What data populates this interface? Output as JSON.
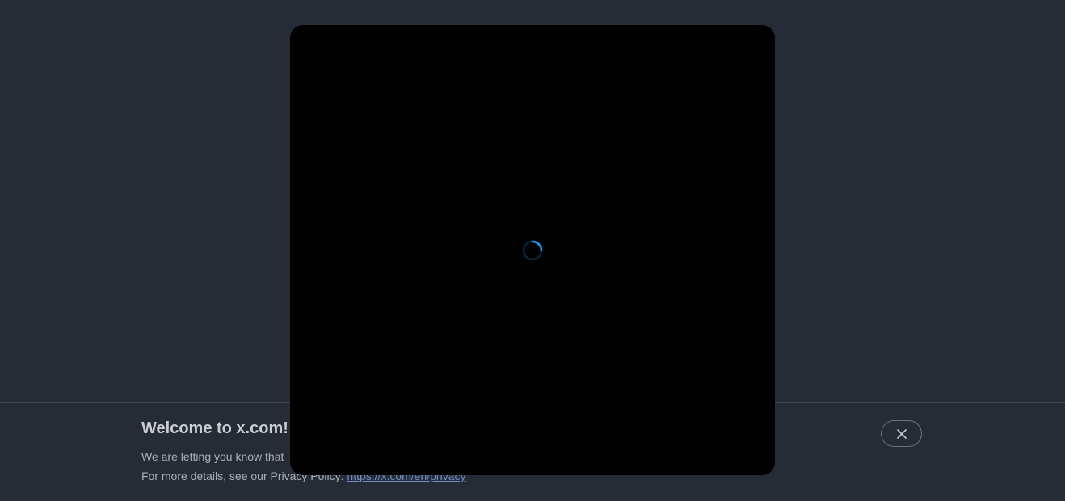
{
  "banner": {
    "title": "Welcome to x.com!",
    "line1": "We are letting you know that",
    "line2_prefix": "For more details, see our Privacy Policy: ",
    "privacy_link": "https://x.com/en/privacy",
    "close_icon": "close-icon"
  },
  "modal": {
    "loading_icon": "spinner-icon",
    "accent_color": "#1d9bf0"
  },
  "colors": {
    "background": "#252c35",
    "modal": "#000000",
    "link": "#6f8fc9"
  }
}
